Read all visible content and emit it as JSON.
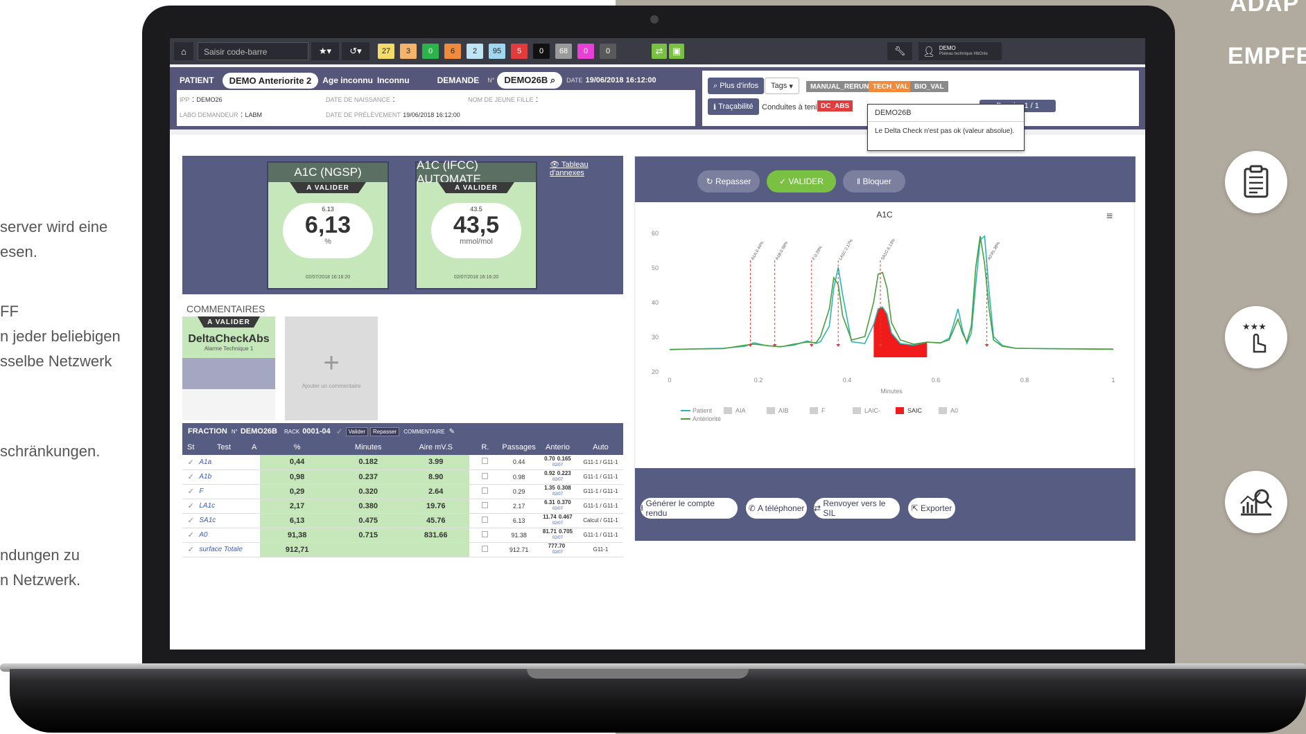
{
  "bg_left_text": {
    "l1": "server wird eine",
    "l2": "esen.",
    "l3": "FF",
    "l4": "n jeder beliebigen",
    "l5": "sselbe Netzwerk",
    "l6": "schränkungen.",
    "l7": "ndungen zu",
    "l8": "n Netzwerk."
  },
  "right_panel": {
    "title1": "ADAP",
    "title2": "EMPFE"
  },
  "topbar": {
    "scan_placeholder": "Saisir code-barre",
    "counters": [
      {
        "label": "27",
        "color": "#f4dc6a"
      },
      {
        "label": "3",
        "color": "#f4b46a"
      },
      {
        "label": "0",
        "color": "#2cb34a"
      },
      {
        "label": "6",
        "color": "#f08a3c"
      },
      {
        "label": "2",
        "color": "#bfe4f5"
      },
      {
        "label": "95",
        "color": "#9fd6f0"
      },
      {
        "label": "5",
        "color": "#e23b3b"
      },
      {
        "label": "0",
        "color": "#111111"
      },
      {
        "label": "68",
        "color": "#9a9a9a"
      },
      {
        "label": "0",
        "color": "#e83fd6"
      },
      {
        "label": "0",
        "color": "#595959"
      }
    ],
    "user_name": "DEMO",
    "user_role": "Plateau technique HbOnle"
  },
  "patient": {
    "section_label": "PATIENT",
    "name": "DEMO Anteriorite 2",
    "age": "Age inconnu",
    "sex": "Inconnu",
    "demande_label": "DEMANDE",
    "num_label": "N°",
    "demande_id": "DEMO26B",
    "date_label": "DATE",
    "date": "19/06/2018 16:12:00",
    "ipp_label": "IPP",
    "ipp": "DEMO26",
    "labo_label": "LABO DEMANDEUR",
    "labo": "LABM",
    "birth_label": "DATE DE NAISSANCE",
    "prel_label": "DATE DE PRÉLÈVEMENT",
    "prel_date": "19/06/2018 16:12:00",
    "maiden_label": "NOM DE JEUNE FILLE"
  },
  "actions": {
    "plus_infos": "Plus d'infos",
    "tags": "Tags",
    "tag_list": [
      "MANUAL_RERUN",
      "TECH_VAL",
      "BIO_VAL"
    ],
    "tracabilite": "Traçabilité",
    "conduites": "Conduites à tenir :",
    "dc_abs": "DC_ABS",
    "dossier": "Dossier 1 / 1"
  },
  "tooltip": {
    "title": "DEMO26B",
    "text": "Le Delta Check n'est pas ok (valeur absolue)."
  },
  "cards": [
    {
      "title": "A1C (NGSP)",
      "status": "A VALIDER",
      "raw": "6.13",
      "value": "6,13",
      "unit": "%",
      "timestamp": "02/07/2018 16:16:20"
    },
    {
      "title": "A1C (IFCC) AUTOMATE",
      "status": "A VALIDER",
      "raw": "43.5",
      "value": "43,5",
      "unit": "mmol/mol",
      "timestamp": "02/07/2018 16:16:20"
    }
  ],
  "annexes_link": "Tableau d'annexes",
  "comments": {
    "title": "COMMENTAIRES",
    "card_status": "A VALIDER",
    "card_title": "DeltaCheckAbs",
    "card_subtitle": "Alarme Technique 1",
    "add_label": "Ajouter un commentaire",
    "add_symbol": "+"
  },
  "fraction": {
    "label": "FRACTION",
    "num_label": "N°",
    "id": "DEMO26B",
    "rack_label": "RACK",
    "rack": "0001-04",
    "valider": "Valider",
    "repasser": "Repasser",
    "commentaire": "COMMENTAIRE",
    "headers": [
      "St",
      "Test",
      "A",
      "%",
      "Minutes",
      "Aire mV.S",
      "R.",
      "Passages",
      "Anterio",
      "Auto"
    ],
    "rows": [
      {
        "test": "A1a",
        "pct": "0,44",
        "min": "0.182",
        "aire": "3.99",
        "pass": "0.44",
        "a1": "0.70",
        "a2": "0.165",
        "d": "02/07",
        "auto": "G11-1 / G11-1"
      },
      {
        "test": "A1b",
        "pct": "0,98",
        "min": "0.237",
        "aire": "8.90",
        "pass": "0.98",
        "a1": "0.92",
        "a2": "0.223",
        "d": "02/07",
        "auto": "G11-1 / G11-1"
      },
      {
        "test": "F",
        "pct": "0,29",
        "min": "0.320",
        "aire": "2.64",
        "pass": "0.29",
        "a1": "1.35",
        "a2": "0.308",
        "d": "02/07",
        "auto": "G11-1 / G11-1"
      },
      {
        "test": "LA1c",
        "pct": "2,17",
        "min": "0.380",
        "aire": "19.76",
        "pass": "2.17",
        "a1": "6.31",
        "a2": "0.370",
        "d": "02/07",
        "auto": "G11-1 / G11-1"
      },
      {
        "test": "SA1c",
        "pct": "6,13",
        "min": "0.475",
        "aire": "45.76",
        "pass": "6.13",
        "a1": "11.74",
        "a2": "0.467",
        "d": "02/07",
        "auto": "Calcul / G11-1"
      },
      {
        "test": "A0",
        "pct": "91,38",
        "min": "0.715",
        "aire": "831.66",
        "pass": "91.38",
        "a1": "81.71",
        "a2": "0.705",
        "d": "02/07",
        "auto": "G11-1 / G11-1"
      },
      {
        "test": "surface Totale",
        "pct": "912,71",
        "min": "",
        "aire": "",
        "pass": "912.71",
        "a1": "777.70",
        "a2": "",
        "d": "02/07",
        "auto": "G11-1"
      }
    ]
  },
  "chart_buttons": {
    "repasser": "Repasser",
    "valider": "VALIDER",
    "bloquer": "Bloquer"
  },
  "chart_data": {
    "type": "line",
    "title": "A1C",
    "xlabel": "Minutes",
    "ylabel": "",
    "xlim": [
      0,
      1
    ],
    "ylim": [
      20,
      60
    ],
    "x_ticks": [
      "0",
      "0.2",
      "0.4",
      "0.6",
      "0.8",
      "1"
    ],
    "y_ticks": [
      "20",
      "30",
      "40",
      "50",
      "60"
    ],
    "peak_annotations": [
      {
        "x": 0.182,
        "label": "A1A:0.44%"
      },
      {
        "x": 0.237,
        "label": "A1B:0.98%"
      },
      {
        "x": 0.32,
        "label": "F:0.29%"
      },
      {
        "x": 0.38,
        "label": "LA1C:2.17%"
      },
      {
        "x": 0.475,
        "label": "SA1C:6.13%"
      },
      {
        "x": 0.715,
        "label": "A0:91.38%"
      }
    ],
    "series": [
      {
        "name": "Patient",
        "color": "#27b7b5",
        "x": [
          0,
          0.05,
          0.12,
          0.17,
          0.19,
          0.22,
          0.25,
          0.28,
          0.31,
          0.33,
          0.34,
          0.36,
          0.37,
          0.38,
          0.39,
          0.41,
          0.44,
          0.46,
          0.47,
          0.48,
          0.49,
          0.5,
          0.52,
          0.55,
          0.58,
          0.61,
          0.63,
          0.64,
          0.65,
          0.66,
          0.67,
          0.68,
          0.69,
          0.7,
          0.71,
          0.72,
          0.73,
          0.75,
          0.78,
          0.85,
          1.0
        ],
        "y": [
          26.3,
          26.4,
          26.6,
          27.2,
          28.2,
          27.3,
          27.1,
          27.5,
          28.7,
          28.0,
          28.5,
          33.0,
          44.0,
          50.0,
          42.0,
          28.5,
          28.0,
          33.5,
          38.0,
          38.5,
          36.5,
          31.0,
          28.0,
          27.5,
          28.4,
          28.1,
          29.5,
          33.5,
          38.0,
          32.0,
          28.0,
          31.0,
          45.0,
          58.0,
          59.0,
          43.0,
          30.0,
          27.4,
          26.6,
          26.5,
          26.4
        ]
      },
      {
        "name": "Antériorité",
        "color": "#4a9e3a",
        "x": [
          0,
          0.05,
          0.12,
          0.17,
          0.19,
          0.22,
          0.25,
          0.28,
          0.31,
          0.33,
          0.34,
          0.36,
          0.37,
          0.38,
          0.39,
          0.41,
          0.44,
          0.46,
          0.47,
          0.48,
          0.49,
          0.5,
          0.52,
          0.55,
          0.58,
          0.61,
          0.63,
          0.64,
          0.65,
          0.66,
          0.67,
          0.68,
          0.69,
          0.7,
          0.71,
          0.72,
          0.73,
          0.75,
          0.78,
          0.85,
          1.0
        ],
        "y": [
          26.2,
          26.4,
          26.5,
          27.5,
          27.8,
          27.4,
          27.0,
          27.8,
          28.4,
          28.2,
          30.0,
          38.0,
          47.0,
          45.0,
          36.0,
          29.0,
          30.0,
          40.0,
          48.0,
          48.5,
          44.0,
          34.0,
          29.0,
          27.8,
          28.4,
          28.2,
          29.0,
          32.0,
          35.0,
          31.0,
          28.5,
          33.0,
          50.0,
          59.0,
          51.0,
          38.0,
          29.0,
          27.2,
          26.6,
          26.5,
          26.3
        ]
      }
    ],
    "shaded_peak": {
      "name": "SAIC",
      "color": "#f11b1b",
      "x": [
        0.46,
        0.47,
        0.48,
        0.49,
        0.5,
        0.52,
        0.55,
        0.58
      ],
      "y": [
        33.5,
        38.0,
        38.5,
        36.5,
        31.0,
        28.0,
        27.5,
        28.4
      ]
    },
    "legend": [
      {
        "name": "Patient",
        "color": "#27b7b5",
        "kind": "line"
      },
      {
        "name": "Antériorité",
        "color": "#4a9e3a",
        "kind": "line"
      },
      {
        "name": "AIA",
        "color": "#cfcfcf",
        "kind": "box"
      },
      {
        "name": "AIB",
        "color": "#cfcfcf",
        "kind": "box"
      },
      {
        "name": "F",
        "color": "#cfcfcf",
        "kind": "box"
      },
      {
        "name": "LAIC-",
        "color": "#cfcfcf",
        "kind": "box"
      },
      {
        "name": "SAIC",
        "color": "#f11b1b",
        "kind": "box"
      },
      {
        "name": "A0",
        "color": "#cfcfcf",
        "kind": "box"
      }
    ],
    "legend_position": "bottom",
    "grid": false
  },
  "bottom_buttons": {
    "generer": "Générer le compte rendu",
    "telephoner": "A téléphoner",
    "renvoyer": "Renvoyer vers le SIL",
    "exporter": "Exporter"
  }
}
